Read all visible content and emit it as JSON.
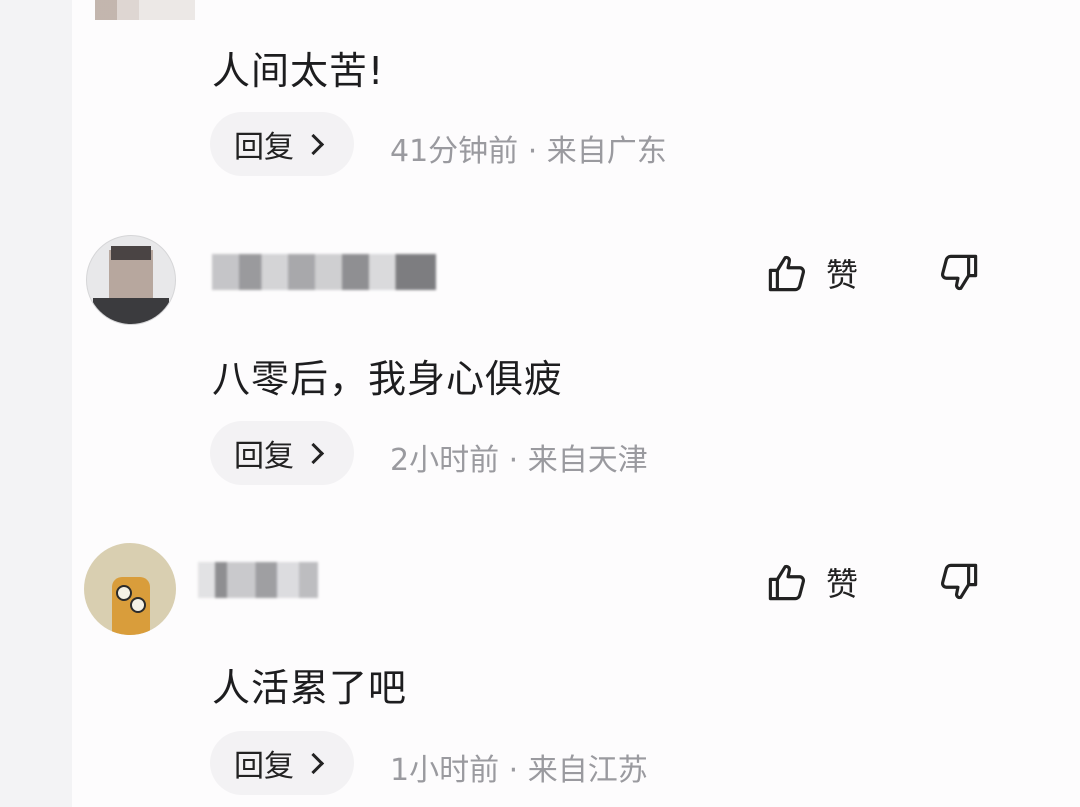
{
  "comments": [
    {
      "text": "人间太苦!",
      "reply_label": "回复",
      "meta": "41分钟前 · 来自广东"
    },
    {
      "text": "八零后，我身心俱疲",
      "reply_label": "回复",
      "meta": "2小时前 · 来自天津",
      "like_label": "赞"
    },
    {
      "text": "人活累了吧",
      "reply_label": "回复",
      "meta": "1小时前 · 来自江苏",
      "like_label": "赞"
    }
  ],
  "icons": {
    "like": "thumbs-up-icon",
    "dislike": "thumbs-down-icon",
    "reply_chevron": "chevron-right-icon"
  },
  "colors": {
    "page_background": "#f3f3f5",
    "panel_background": "#fdfcfd",
    "text_primary": "#1d1d1f",
    "text_meta": "#9a9a9f",
    "pill_background": "#f3f2f4"
  }
}
